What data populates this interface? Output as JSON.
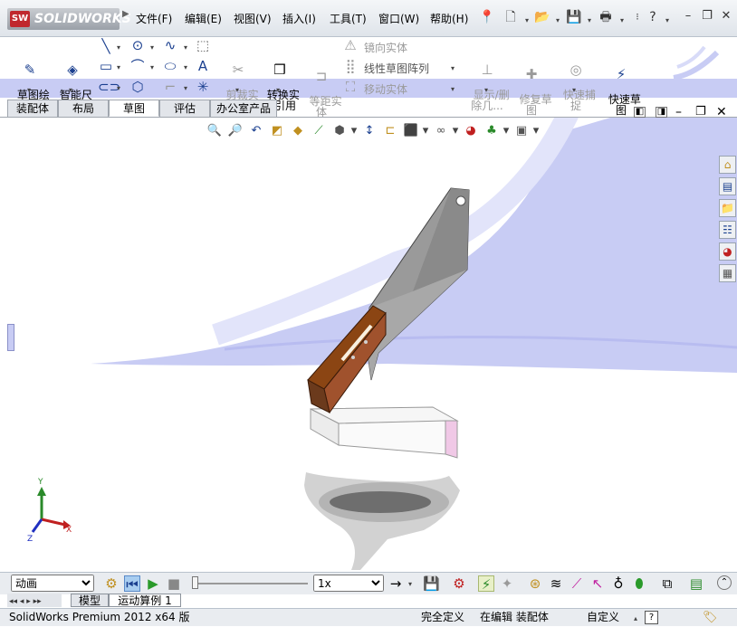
{
  "app": {
    "logo_text": "SOLIDWORKS",
    "logo_badge": "SW",
    "menu": [
      "文件(F)",
      "编辑(E)",
      "视图(V)",
      "插入(I)",
      "工具(T)",
      "窗口(W)",
      "帮助(H)"
    ],
    "help_symbol": "?"
  },
  "command_manager": {
    "sketch_draw": "草图绘\n制",
    "smart_dimension": "智能尺\n寸",
    "trim_entities": "剪裁实\n体(T)",
    "convert_entities": "转换实\n体引用",
    "offset_entities": "等距实\n体",
    "mirror_entities": "镜向实体",
    "linear_pattern": "线性草图阵列",
    "move_entities": "移动实体",
    "show_delete_relations": "显示/删\n除几...",
    "repair_sketch": "修复草\n图",
    "quick_snaps": "快速捕\n捉",
    "rapid_sketch": "快速草\n图"
  },
  "tabs": [
    "装配体",
    "布局",
    "草图",
    "评估",
    "办公室产品"
  ],
  "active_tab": "草图",
  "viewport": {
    "background_colors": {
      "floor": "#c8ccf4",
      "blade": "#8a8a8a",
      "handle": "#8b4513",
      "block": "#f4f4f4",
      "block_end": "#f0c8e6",
      "shadow": "#b0b0b0"
    },
    "triad": {
      "x": "X",
      "y": "Y",
      "z": "Z"
    }
  },
  "motion": {
    "study_type": "动画",
    "speed": "1x",
    "playback_position": 0.0
  },
  "bottom_tabs": [
    "模型",
    "运动算例 1"
  ],
  "active_bottom_tab": "运动算例 1",
  "status": {
    "product": "SolidWorks Premium 2012 x64 版",
    "fully_defined": "完全定义",
    "editing": "在编辑 装配体",
    "custom": "自定义"
  }
}
